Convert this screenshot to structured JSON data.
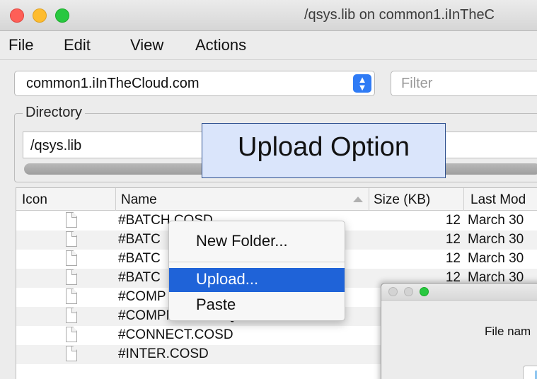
{
  "window": {
    "title": "/qsys.lib on common1.iInTheC"
  },
  "menubar": {
    "items": [
      "File",
      "Edit",
      "View",
      "Actions"
    ]
  },
  "toolbar": {
    "host": "common1.iInTheCloud.com",
    "filter_placeholder": "Filter"
  },
  "directory": {
    "legend": "Directory",
    "path": "/qsys.lib"
  },
  "callout": {
    "text": "Upload Option"
  },
  "table": {
    "columns": [
      "Icon",
      "Name",
      "Size (KB)",
      "Last Mod"
    ],
    "rows": [
      {
        "name": "#BATCH.COSD",
        "size": "12",
        "date": "March 30"
      },
      {
        "name": "#BATC",
        "size": "12",
        "date": "March 30"
      },
      {
        "name": "#BATC",
        "size": "12",
        "date": "March 30"
      },
      {
        "name": "#BATC",
        "size": "12",
        "date": "March 30"
      },
      {
        "name": "#COMP",
        "size": "",
        "date": ""
      },
      {
        "name": "#COMPN##.MSGQ",
        "size": "",
        "date": ""
      },
      {
        "name": "#CONNECT.COSD",
        "size": "",
        "date": ""
      },
      {
        "name": "#INTER.COSD",
        "size": "",
        "date": ""
      }
    ]
  },
  "context_menu": {
    "items": [
      {
        "label": "New Folder..."
      },
      {
        "label": "Upload..."
      },
      {
        "label": "Paste"
      }
    ],
    "selected": "Upload..."
  },
  "dialog": {
    "label": "File nam"
  },
  "colors": {
    "accent": "#1f63d8",
    "callout_fill": "#dae5fb",
    "callout_border": "#2d4f8e"
  }
}
